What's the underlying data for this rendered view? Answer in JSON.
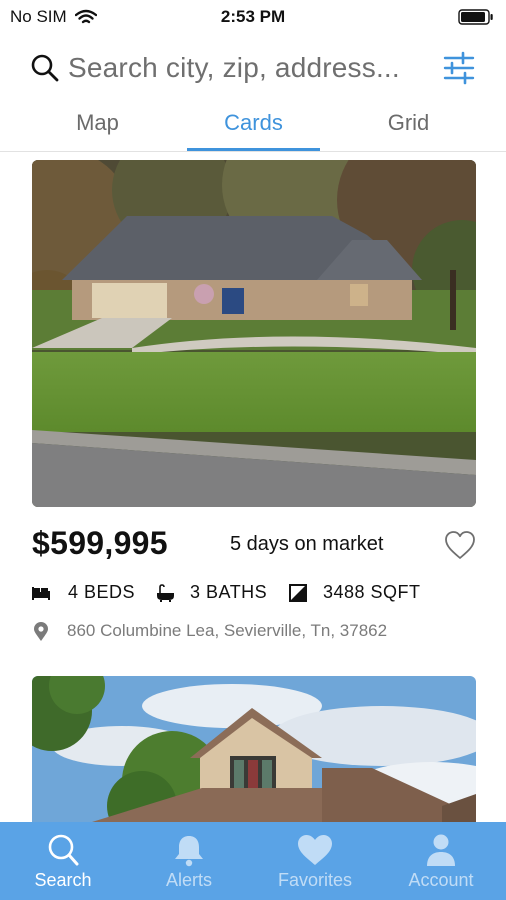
{
  "status_bar": {
    "carrier": "No SIM",
    "time": "2:53 PM"
  },
  "search": {
    "placeholder": "Search city, zip, address...",
    "icon": "search-icon",
    "filter_icon": "sliders-icon"
  },
  "tabs": [
    {
      "label": "Map",
      "active": false
    },
    {
      "label": "Cards",
      "active": true
    },
    {
      "label": "Grid",
      "active": false
    }
  ],
  "listings": [
    {
      "price": "$599,995",
      "days_on_market": "5 days on market",
      "beds": "4 BEDS",
      "baths": "3 BATHS",
      "sqft": "3488 SQFT",
      "address": "860 Columbine Lea, Sevierville, Tn, 37862",
      "favorite": false
    }
  ],
  "bottom_nav": [
    {
      "label": "Search",
      "icon": "search-icon",
      "active": true
    },
    {
      "label": "Alerts",
      "icon": "bell-icon",
      "active": false
    },
    {
      "label": "Favorites",
      "icon": "heart-icon",
      "active": false
    },
    {
      "label": "Account",
      "icon": "person-icon",
      "active": false
    }
  ],
  "colors": {
    "accent": "#3f93dc",
    "nav_background": "#5aa3e6",
    "muted_text": "#7b7b7b"
  }
}
